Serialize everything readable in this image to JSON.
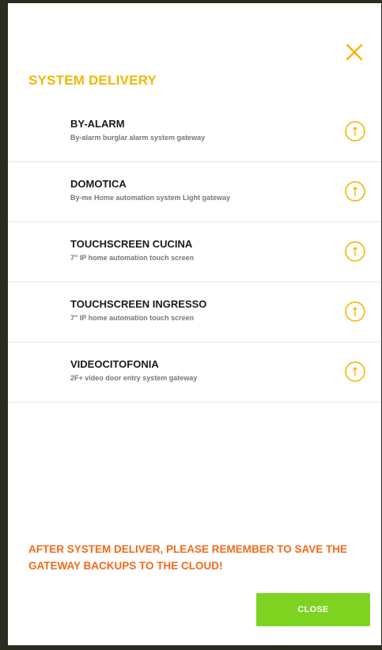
{
  "dialog": {
    "title": "SYSTEM DELIVERY",
    "close_icon": "close-x-icon",
    "warning": "AFTER SYSTEM DELIVER, PLEASE REMEMBER TO SAVE THE GATEWAY BACKUPS TO THE CLOUD!",
    "close_button_label": "CLOSE"
  },
  "gateways": [
    {
      "name": "BY-ALARM",
      "description": "By-alarm burglar alarm system gateway",
      "icon": "upload-circle-icon"
    },
    {
      "name": "DOMOTICA",
      "description": "By-me Home automation system Light gateway",
      "icon": "upload-circle-icon"
    },
    {
      "name": "TOUCHSCREEN CUCINA",
      "description": "7'' IP home automation touch screen",
      "icon": "upload-circle-icon"
    },
    {
      "name": "TOUCHSCREEN INGRESSO",
      "description": "7'' IP home automation touch screen",
      "icon": "upload-circle-icon"
    },
    {
      "name": "VIDEOCITOFONIA",
      "description": "2F+ video door entry system gateway",
      "icon": "upload-circle-icon"
    }
  ],
  "colors": {
    "accent_yellow": "#f2b705",
    "warning_orange": "#f26a1b",
    "button_green": "#7ed321",
    "divider": "#e6e6e6"
  }
}
